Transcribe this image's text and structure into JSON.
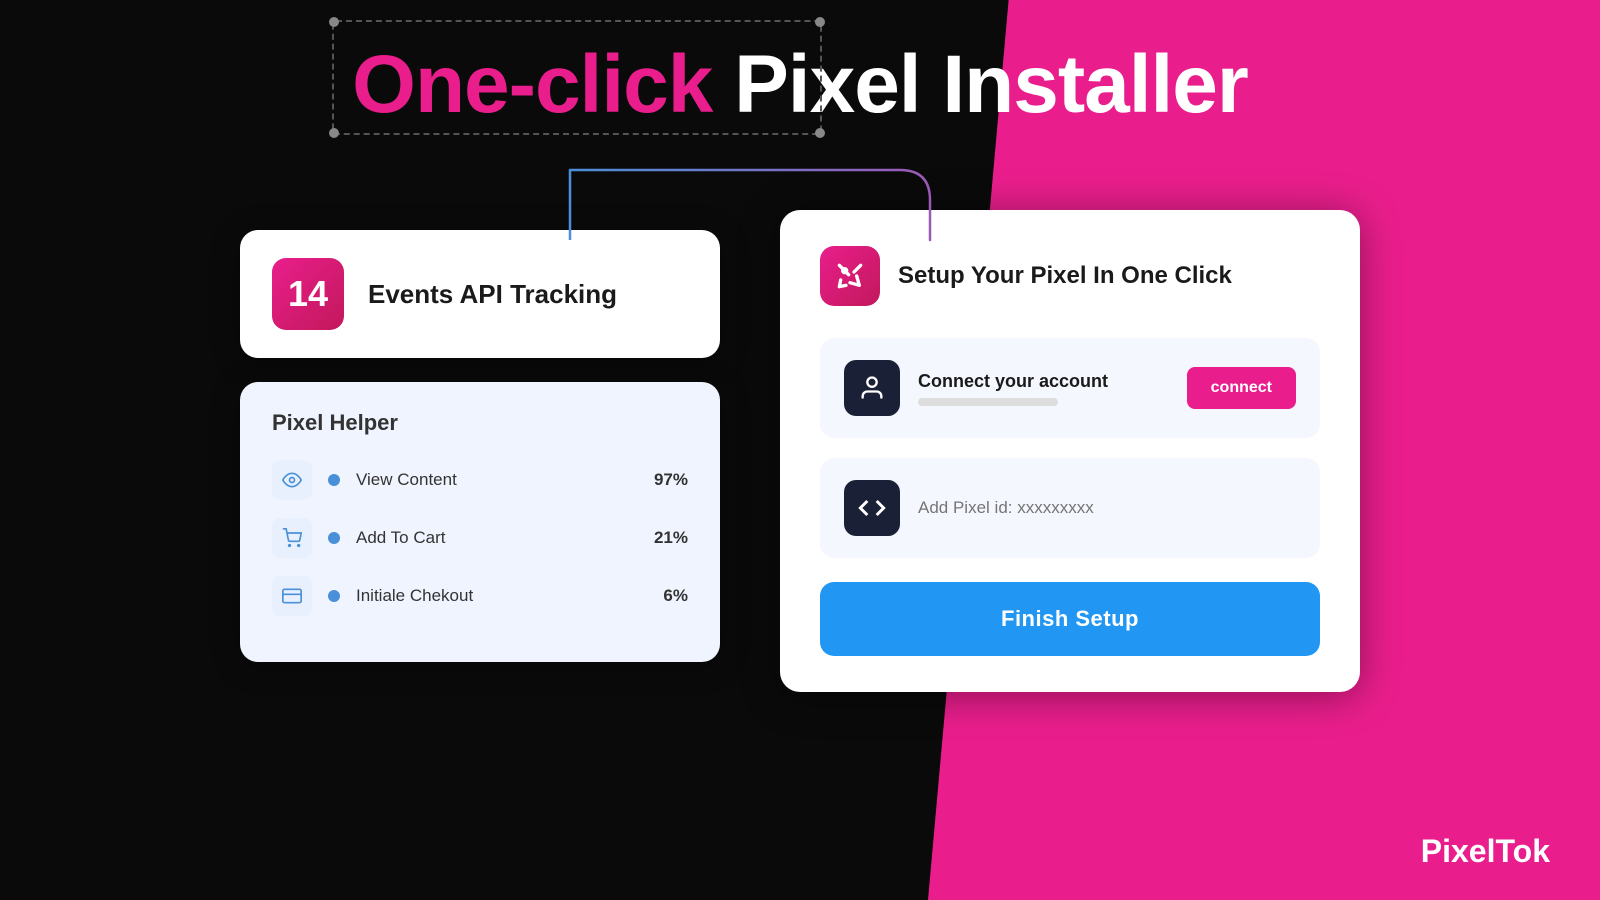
{
  "header": {
    "title_highlight": "One-click",
    "title_rest": " Pixel Installer"
  },
  "left_column": {
    "events_card": {
      "badge_number": "14",
      "label": "Events API Tracking"
    },
    "helper_card": {
      "title": "Pixel Helper",
      "rows": [
        {
          "icon": "eye",
          "label": "View Content",
          "percent": "97%"
        },
        {
          "icon": "cart",
          "label": "Add To Cart",
          "percent": "21%"
        },
        {
          "icon": "card",
          "label": "Initiale Chekout",
          "percent": "6%"
        }
      ]
    }
  },
  "right_card": {
    "title": "Setup Your Pixel In One Click",
    "connect_row": {
      "label": "Connect your account",
      "button": "connect"
    },
    "pixel_row": {
      "placeholder": "Add Pixel id: xxxxxxxxx"
    },
    "finish_button": "Finish Setup"
  },
  "logo": {
    "pixel": "Pixel",
    "tok": "Tok"
  }
}
